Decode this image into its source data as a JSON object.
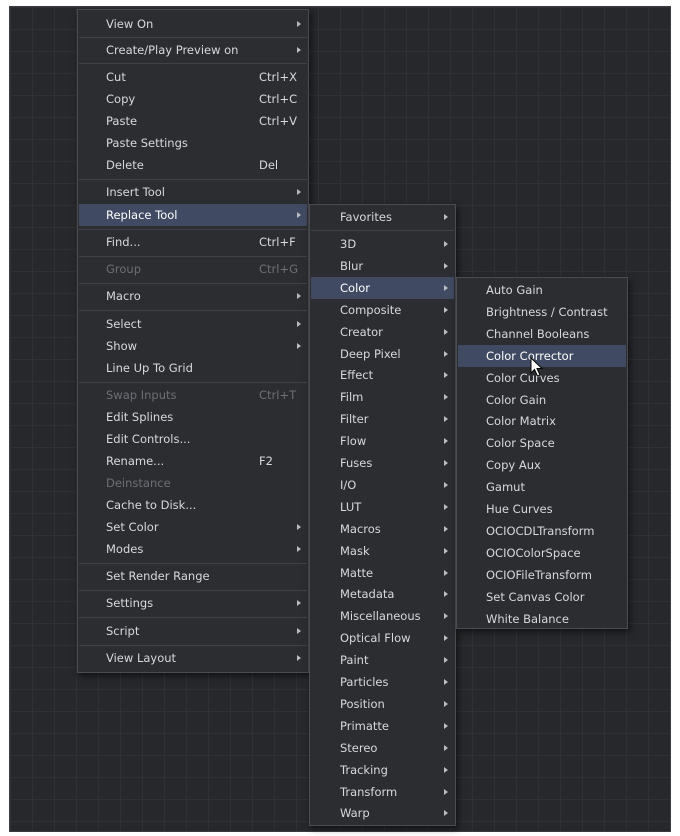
{
  "main_menu": [
    {
      "label": "View On",
      "submenu": true
    },
    {
      "label": "Create/Play Preview on",
      "submenu": true
    },
    {
      "label": "Cut",
      "shortcut": "Ctrl+X"
    },
    {
      "label": "Copy",
      "shortcut": "Ctrl+C"
    },
    {
      "label": "Paste",
      "shortcut": "Ctrl+V"
    },
    {
      "label": "Paste Settings"
    },
    {
      "label": "Delete",
      "shortcut": "Del"
    },
    {
      "label": "Insert Tool",
      "submenu": true
    },
    {
      "label": "Replace Tool",
      "submenu": true,
      "highlighted": true
    },
    {
      "label": "Find...",
      "shortcut": "Ctrl+F"
    },
    {
      "label": "Group",
      "shortcut": "Ctrl+G",
      "disabled": true
    },
    {
      "label": "Macro",
      "submenu": true
    },
    {
      "label": "Select",
      "submenu": true
    },
    {
      "label": "Show",
      "submenu": true
    },
    {
      "label": "Line Up To Grid"
    },
    {
      "label": "Swap Inputs",
      "shortcut": "Ctrl+T",
      "disabled": true
    },
    {
      "label": "Edit Splines"
    },
    {
      "label": "Edit Controls..."
    },
    {
      "label": "Rename...",
      "shortcut": "F2"
    },
    {
      "label": "Deinstance",
      "disabled": true
    },
    {
      "label": "Cache to Disk..."
    },
    {
      "label": "Set Color",
      "submenu": true
    },
    {
      "label": "Modes",
      "submenu": true
    },
    {
      "label": "Set Render Range"
    },
    {
      "label": "Settings",
      "submenu": true
    },
    {
      "label": "Script",
      "submenu": true
    },
    {
      "label": "View Layout",
      "submenu": true
    }
  ],
  "replace_tool_menu": [
    "Favorites",
    "3D",
    "Blur",
    "Color",
    "Composite",
    "Creator",
    "Deep Pixel",
    "Effect",
    "Film",
    "Filter",
    "Flow",
    "Fuses",
    "I/O",
    "LUT",
    "Macros",
    "Mask",
    "Matte",
    "Metadata",
    "Miscellaneous",
    "Optical Flow",
    "Paint",
    "Particles",
    "Position",
    "Primatte",
    "Stereo",
    "Tracking",
    "Transform",
    "Warp"
  ],
  "replace_tool_highlighted": "Color",
  "color_menu": [
    "Auto Gain",
    "Brightness / Contrast",
    "Channel Booleans",
    "Color Corrector",
    "Color Curves",
    "Color Gain",
    "Color Matrix",
    "Color Space",
    "Copy Aux",
    "Gamut",
    "Hue Curves",
    "OCIOCDLTransform",
    "OCIOColorSpace",
    "OCIOFileTransform",
    "Set Canvas Color",
    "White Balance"
  ],
  "color_menu_highlighted": "Color Corrector",
  "colors": {
    "canvas": "#26282b",
    "menu_bg": "#2b2d31",
    "highlight": "#414a63",
    "text": "#d7d9dd",
    "disabled_text": "#6c6f74"
  }
}
